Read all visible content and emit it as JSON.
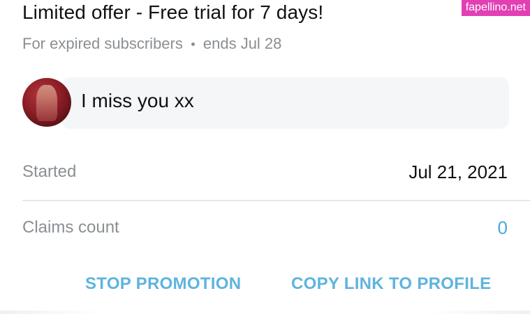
{
  "promotion": {
    "title": "Limited offer - Free trial for 7 days!",
    "audience": "For expired subscribers",
    "ends": "ends Jul 28"
  },
  "watermark": {
    "text": "fapellino.net",
    "color": "#e23fb5"
  },
  "message": {
    "text": "I miss you xx",
    "avatar_icon": "user-avatar"
  },
  "details": {
    "started_label": "Started",
    "started_value": "Jul 21, 2021",
    "claims_label": "Claims count",
    "claims_value": "0"
  },
  "actions": {
    "stop_label": "STOP PROMOTION",
    "copy_label": "COPY LINK TO PROFILE"
  },
  "colors": {
    "accent": "#5fb3de",
    "muted": "#8a8f93",
    "text": "#111111",
    "bubble_bg": "#f5f6f7"
  }
}
